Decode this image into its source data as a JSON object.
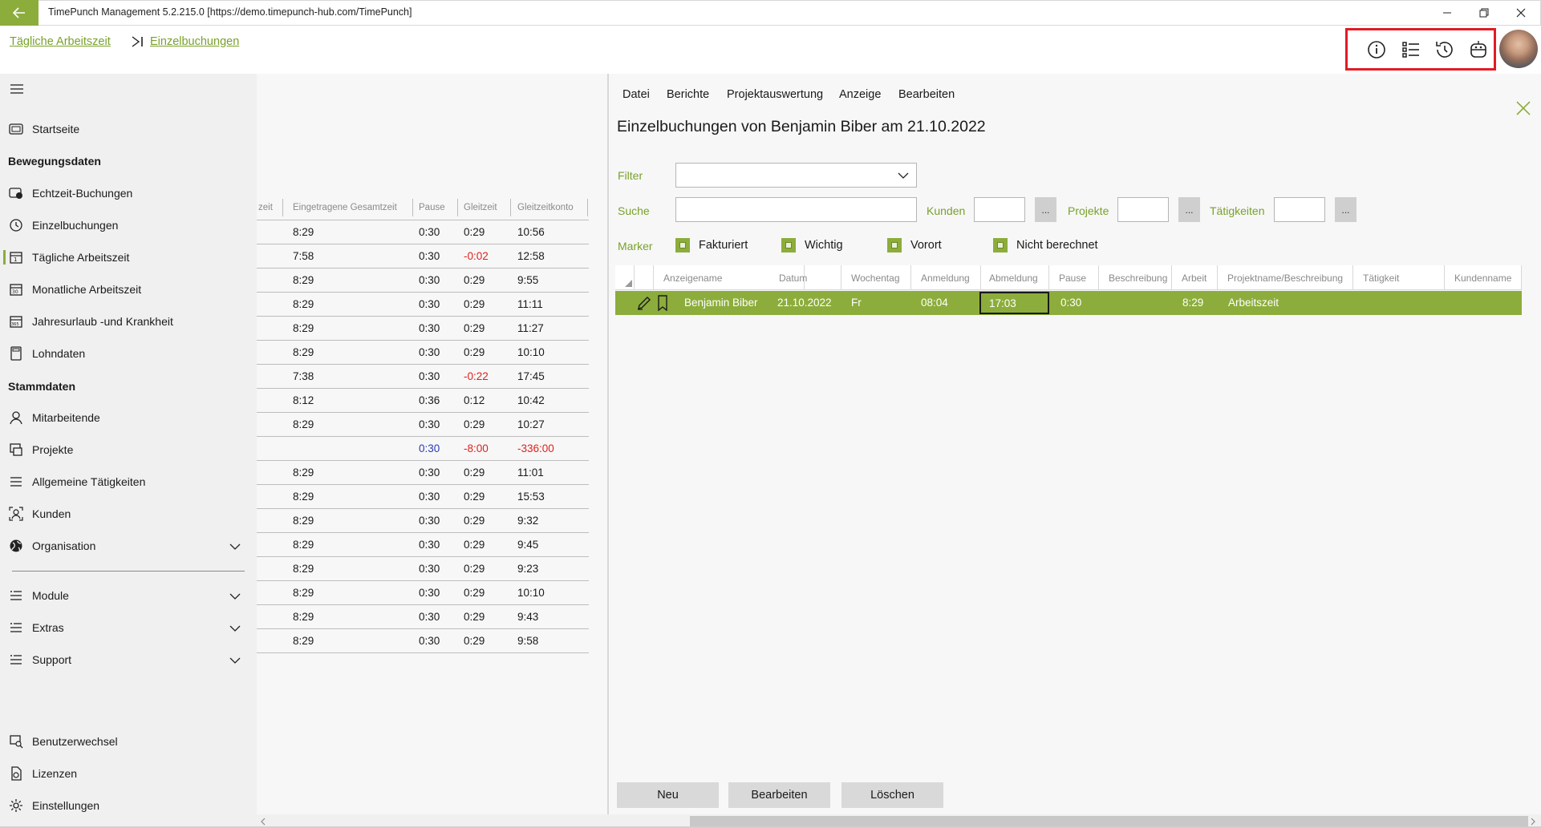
{
  "window": {
    "title": "TimePunch Management 5.2.215.0 [https://demo.timepunch-hub.com/TimePunch]"
  },
  "breadcrumb": {
    "first": "Tägliche Arbeitszeit",
    "second": "Einzelbuchungen"
  },
  "header_icons": [
    "info-icon",
    "checklist-icon",
    "history-icon",
    "robot-icon"
  ],
  "sidebar": {
    "home": "Startseite",
    "section_movement": "Bewegungsdaten",
    "movement_items": [
      "Echtzeit-Buchungen",
      "Einzelbuchungen",
      "Tägliche Arbeitszeit",
      "Monatliche Arbeitszeit",
      "Jahresurlaub -und Krankheit",
      "Lohndaten"
    ],
    "section_master": "Stammdaten",
    "master_items": [
      "Mitarbeitende",
      "Projekte",
      "Allgemeine Tätigkeiten",
      "Kunden",
      "Organisation"
    ],
    "group_items": [
      "Module",
      "Extras",
      "Support"
    ],
    "bottom_items": [
      "Benutzerwechsel",
      "Lizenzen",
      "Einstellungen"
    ]
  },
  "daily_table": {
    "headers": [
      "zeit",
      "Eingetragene Gesamtzeit",
      "Pause",
      "Gleitzeit",
      "Gleitzeitkonto"
    ],
    "rows": [
      {
        "total": "8:29",
        "pause": "0:30",
        "flex": "0:29",
        "account": "10:56"
      },
      {
        "total": "7:58",
        "pause": "0:30",
        "flex": "-0:02",
        "account": "12:58"
      },
      {
        "total": "8:29",
        "pause": "0:30",
        "flex": "0:29",
        "account": "9:55"
      },
      {
        "total": "8:29",
        "pause": "0:30",
        "flex": "0:29",
        "account": "11:11"
      },
      {
        "total": "8:29",
        "pause": "0:30",
        "flex": "0:29",
        "account": "11:27"
      },
      {
        "total": "8:29",
        "pause": "0:30",
        "flex": "0:29",
        "account": "10:10"
      },
      {
        "total": "7:38",
        "pause": "0:30",
        "flex": "-0:22",
        "account": "17:45"
      },
      {
        "total": "8:12",
        "pause": "0:36",
        "flex": "0:12",
        "account": "10:42"
      },
      {
        "total": "8:29",
        "pause": "0:30",
        "flex": "0:29",
        "account": "10:27"
      },
      {
        "total": "",
        "pause": "0:30",
        "flex": "-8:00",
        "account": "-336:00"
      },
      {
        "total": "8:29",
        "pause": "0:30",
        "flex": "0:29",
        "account": "11:01"
      },
      {
        "total": "8:29",
        "pause": "0:30",
        "flex": "0:29",
        "account": "15:53"
      },
      {
        "total": "8:29",
        "pause": "0:30",
        "flex": "0:29",
        "account": "9:32"
      },
      {
        "total": "8:29",
        "pause": "0:30",
        "flex": "0:29",
        "account": "9:45"
      },
      {
        "total": "8:29",
        "pause": "0:30",
        "flex": "0:29",
        "account": "9:23"
      },
      {
        "total": "8:29",
        "pause": "0:30",
        "flex": "0:29",
        "account": "10:10"
      },
      {
        "total": "8:29",
        "pause": "0:30",
        "flex": "0:29",
        "account": "9:43"
      },
      {
        "total": "8:29",
        "pause": "0:30",
        "flex": "0:29",
        "account": "9:58"
      }
    ]
  },
  "detail": {
    "menu": [
      "Datei",
      "Berichte",
      "Projektauswertung",
      "Anzeige",
      "Bearbeiten"
    ],
    "title": "Einzelbuchungen von Benjamin Biber am 21.10.2022",
    "filter_label": "Filter",
    "filter_value": "",
    "search_label": "Suche",
    "search_value": "",
    "customers_label": "Kunden",
    "projects_label": "Projekte",
    "activities_label": "Tätigkeiten",
    "dots": "...",
    "marker_label": "Marker",
    "markers": [
      "Fakturiert",
      "Wichtig",
      "Vorort",
      "Nicht berechnet"
    ],
    "grid_headers": [
      "Anzeigename",
      "Datum",
      "Wochentag",
      "Anmeldung",
      "Abmeldung",
      "Pause",
      "Beschreibung",
      "Arbeit",
      "Projektname/Beschreibung",
      "Tätigkeit",
      "Kundenname"
    ],
    "row": {
      "name": "Benjamin Biber",
      "date": "21.10.2022",
      "weekday": "Fr",
      "login": "08:04",
      "logout": "17:03",
      "pause": "0:30",
      "description": "",
      "work": "8:29",
      "project": "Arbeitszeit",
      "activity": "",
      "customer": ""
    },
    "buttons": [
      "Neu",
      "Bearbeiten",
      "Löschen"
    ]
  },
  "colors": {
    "accent": "#8cad3b",
    "link": "#79a12a",
    "negative": "#e0201b",
    "pause_blue": "#2a3bb5",
    "highlight_box": "#e01b24"
  }
}
